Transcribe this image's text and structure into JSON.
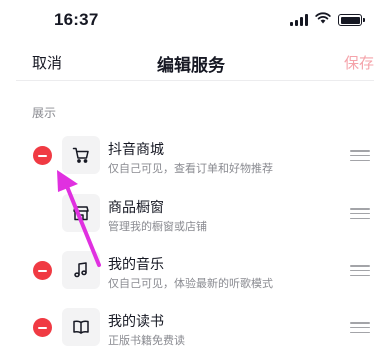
{
  "status_bar": {
    "time": "16:37",
    "icons": [
      "signal-icon",
      "wifi-icon",
      "battery-icon"
    ]
  },
  "nav": {
    "cancel_label": "取消",
    "title": "编辑服务",
    "save_label": "保存",
    "save_color": "#f5a3aa"
  },
  "section": {
    "label": "展示"
  },
  "services": [
    {
      "name": "抖音商城",
      "desc": "仅自己可见，查看订单和好物推荐",
      "icon": "cart-icon",
      "removable": true
    },
    {
      "name": "商品橱窗",
      "desc": "管理我的橱窗或店铺",
      "icon": "storefront-icon",
      "removable": false
    },
    {
      "name": "我的音乐",
      "desc": "仅自己可见，体验最新的听歌模式",
      "icon": "music-note-icon",
      "removable": true
    },
    {
      "name": "我的读书",
      "desc": "正版书籍免费读",
      "icon": "open-book-icon",
      "removable": true
    }
  ],
  "colors": {
    "remove_red": "#f03a43",
    "annotation_arrow": "#e030e0",
    "text_primary": "#161823",
    "text_secondary": "#8a8b91"
  }
}
